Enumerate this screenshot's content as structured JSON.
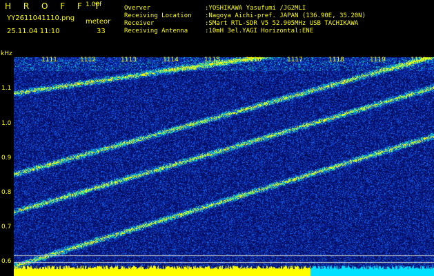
{
  "header": {
    "logo": "H R O F F T",
    "version": "1.00f",
    "filename": "YY2611041110.png",
    "meteor_label": "meteor",
    "datetime": "25.11.04 11:10",
    "meteor_count": "33"
  },
  "info": [
    {
      "key": "Overver",
      "value": ":YOSHIKAWA Yasufumi /JG2MLI"
    },
    {
      "key": "Receiving Location",
      "value": ":Nagoya Aichi-pref. JAPAN (136.90E, 35.20N)"
    },
    {
      "key": "Receiver",
      "value": ":SMart RTL-SDR V5 52.905MHz USB TACHIKAWA"
    },
    {
      "key": "Receiving Antenna",
      "value": ":10mH 3el.YAGI Horizontal:ENE"
    }
  ],
  "axes": {
    "y_unit": "kHz",
    "y_ticks": [
      "1.1",
      "1.0",
      "0.9",
      "0.8",
      "0.7",
      "0.6"
    ],
    "x_ticks": [
      "1111",
      "1112",
      "1113",
      "1114",
      "1115",
      "1116",
      "1117",
      "1118",
      "1119",
      "1120"
    ]
  },
  "colors": {
    "text": "#ffff00",
    "background": "#000000",
    "spectrum_base": "#0b1770",
    "signal_trace": "#ffff00",
    "baseline_strip": "#ffff00",
    "baseline_strip_alt": "#00e0ff"
  }
}
